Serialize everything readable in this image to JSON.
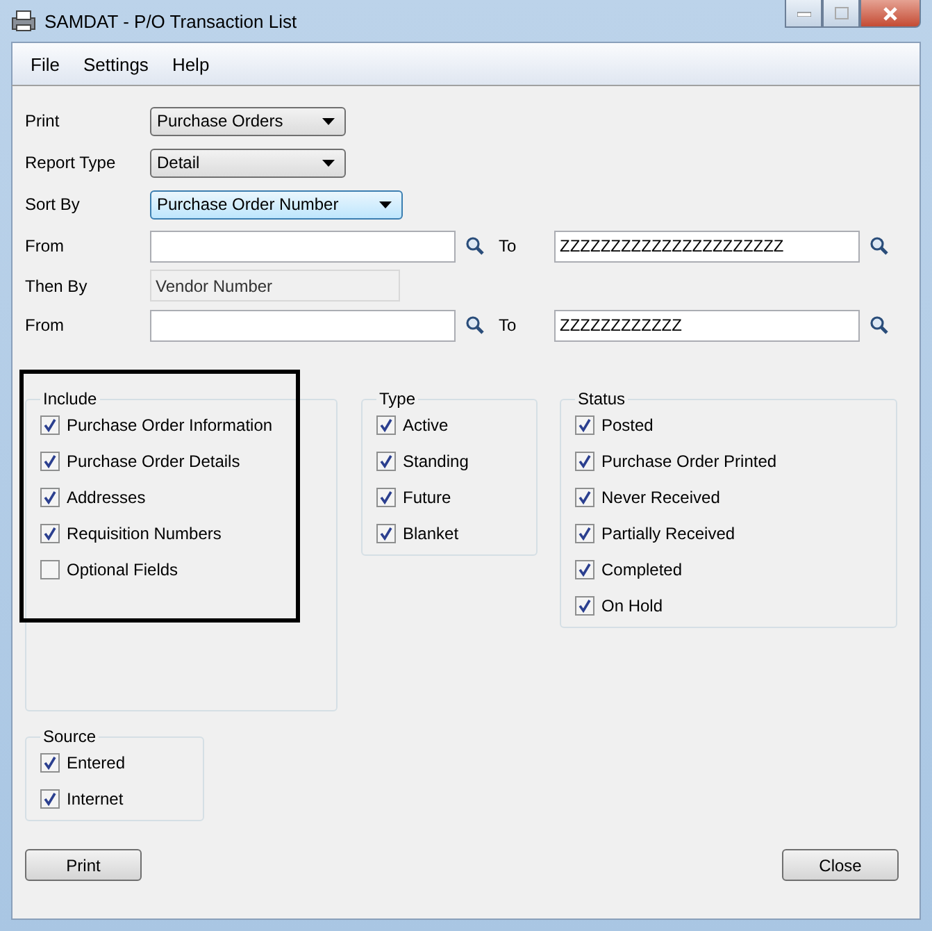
{
  "window": {
    "title": "SAMDAT - P/O Transaction List"
  },
  "menu": [
    "File",
    "Settings",
    "Help"
  ],
  "form": [
    {
      "kind": "select",
      "label": "Print",
      "value": "Purchase Orders",
      "focused": false
    },
    {
      "kind": "select",
      "label": "Report Type",
      "value": "Detail",
      "focused": false
    },
    {
      "kind": "select",
      "label": "Sort By",
      "value": "Purchase Order Number",
      "focused": true
    },
    {
      "kind": "range",
      "label": "From",
      "to_label": "To",
      "to": "ZZZZZZZZZZZZZZZZZZZZZZ"
    },
    {
      "kind": "readonly",
      "label": "Then By",
      "value": "Vendor Number"
    },
    {
      "kind": "range",
      "label": "From",
      "to_label": "To",
      "to": "ZZZZZZZZZZZZ"
    }
  ],
  "include": {
    "title": "Include",
    "highlighted": true,
    "items": [
      {
        "label": "Purchase Order Information",
        "checked": true
      },
      {
        "label": "Purchase Order Details",
        "checked": true
      },
      {
        "label": "Addresses",
        "checked": true
      },
      {
        "label": "Requisition Numbers",
        "checked": true
      },
      {
        "label": "Optional Fields",
        "checked": false
      }
    ]
  },
  "type": {
    "title": "Type",
    "items": [
      {
        "label": "Active",
        "checked": true
      },
      {
        "label": "Standing",
        "checked": true
      },
      {
        "label": "Future",
        "checked": true
      },
      {
        "label": "Blanket",
        "checked": true
      }
    ]
  },
  "status": {
    "title": "Status",
    "items": [
      {
        "label": "Posted",
        "checked": true
      },
      {
        "label": "Purchase Order Printed",
        "checked": true
      },
      {
        "label": "Never Received",
        "checked": true
      },
      {
        "label": "Partially Received",
        "checked": true
      },
      {
        "label": "Completed",
        "checked": true
      },
      {
        "label": "On Hold",
        "checked": true
      }
    ]
  },
  "source": {
    "title": "Source",
    "items": [
      {
        "label": "Entered",
        "checked": true
      },
      {
        "label": "Internet",
        "checked": true
      }
    ]
  },
  "buttons": [
    "Print",
    "Close"
  ]
}
